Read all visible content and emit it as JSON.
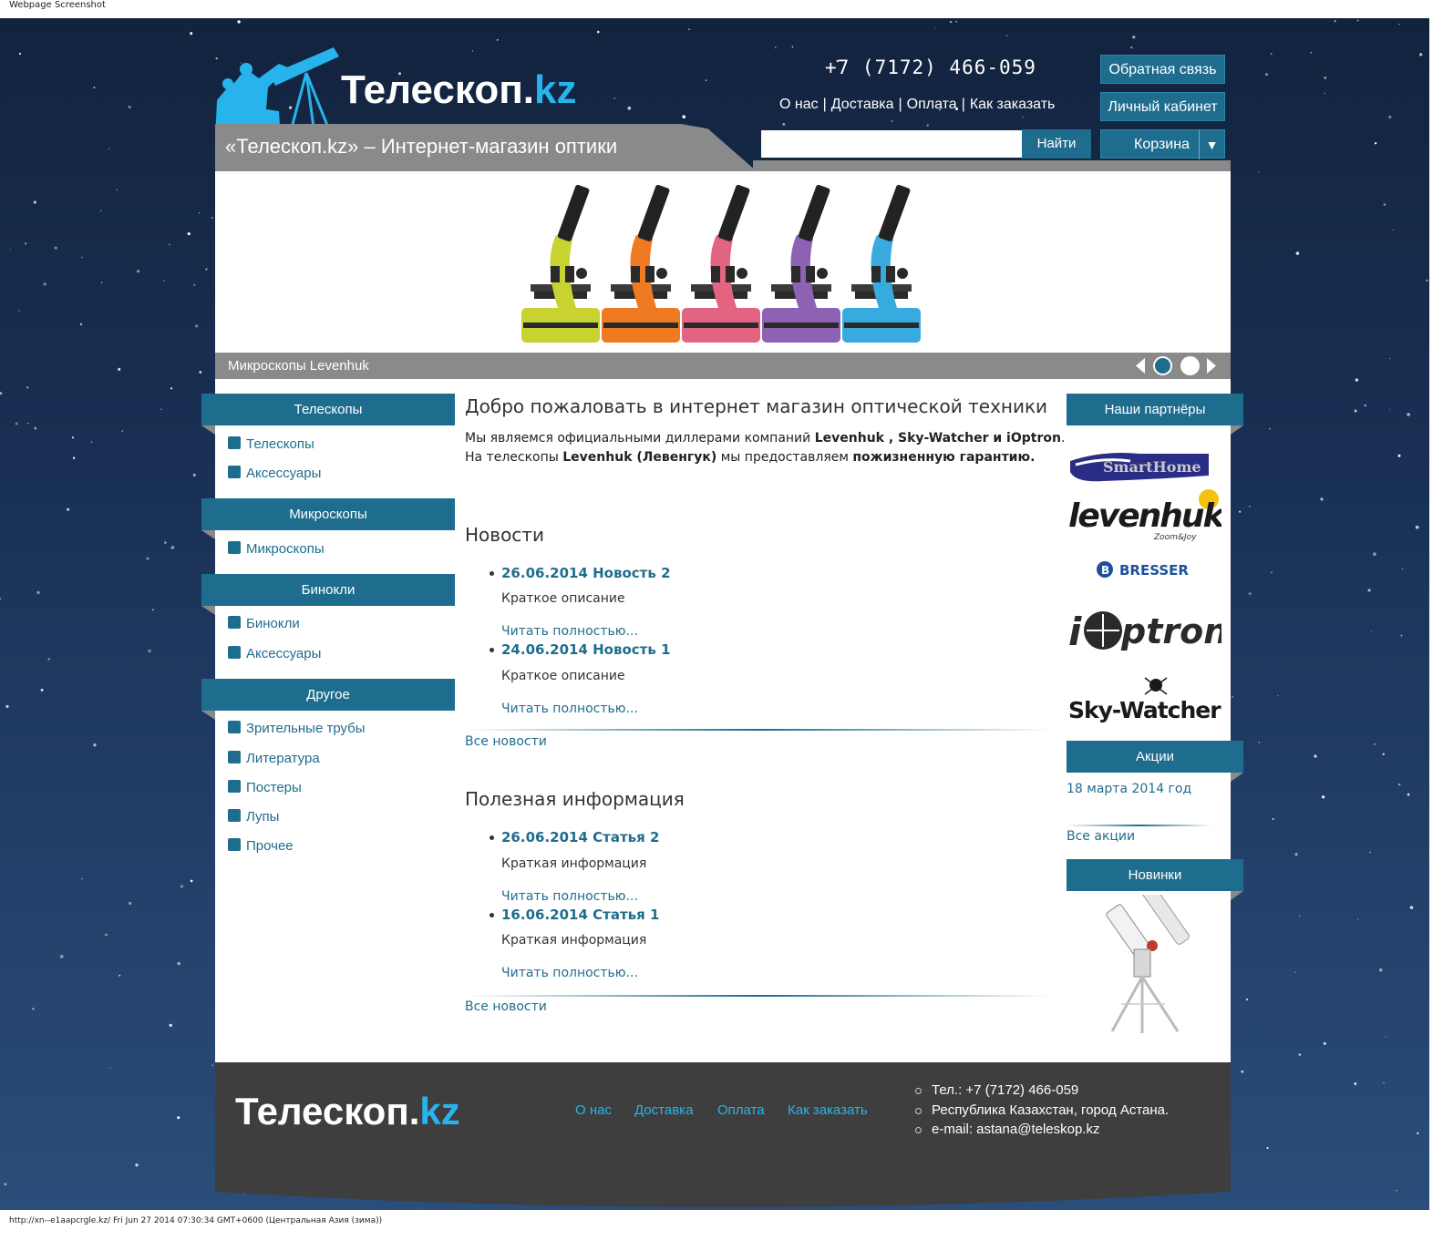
{
  "captions": {
    "top": "Webpage Screenshot",
    "bottom": "http://xn--e1aapcrgle.kz/ Fri Jun 27 2014 07:30:34 GMT+0600 (Центральная Азия (зима))"
  },
  "brand": {
    "name": "Телескоп.",
    "tld": "kz"
  },
  "header": {
    "phone": "+7 (7172) 466-059",
    "nav": [
      "О нас",
      "Доставка",
      "Оплата",
      "Как заказать"
    ],
    "separator": "|",
    "feedback_btn": "Обратная связь",
    "account_btn": "Личный кабинет",
    "tagline": "«Телескоп.kz» – Интернет-магазин оптики",
    "search_btn": "Найти",
    "cart_btn": "Корзина",
    "cart_arrow": "▼"
  },
  "slider": {
    "caption": "Микроскопы Levenhuk",
    "microscope_colors": [
      "#c8d230",
      "#ef7a22",
      "#e26480",
      "#8d62b4",
      "#37aadf"
    ],
    "active_dot": 1
  },
  "left_menu": [
    {
      "title": "Телескопы",
      "items": [
        "Телескопы",
        "Аксессуары"
      ]
    },
    {
      "title": "Микроскопы",
      "items": [
        "Микроскопы"
      ]
    },
    {
      "title": "Бинокли",
      "items": [
        "Бинокли",
        "Аксессуары"
      ]
    },
    {
      "title": "Другое",
      "items": [
        "Зрительные трубы",
        "Литература",
        "Постеры",
        "Лупы",
        "Прочее"
      ]
    }
  ],
  "main": {
    "welcome": "Добро пожаловать в интернет магазин оптической техники",
    "intro": {
      "l1_a": "Мы являемся официальными диллерами компаний ",
      "l1_b": "Levenhuk , Sky-Watcher и iOptron",
      "l1_c": ".",
      "l2_a": "На телескопы ",
      "l2_b": "Levenhuk (Левенгук)",
      "l2_c": " мы предоставляем ",
      "l2_d": "пожизненную гарантию."
    },
    "news_title": "Новости",
    "news": [
      {
        "head": "26.06.2014 Новость 2",
        "desc": "Краткое описание",
        "more": "Читать полностью..."
      },
      {
        "head": "24.06.2014 Новость 1",
        "desc": "Краткое описание",
        "more": "Читать полностью..."
      }
    ],
    "news_all": "Все новости",
    "info_title": "Полезная информация",
    "info": [
      {
        "head": "26.06.2014 Статья 2",
        "desc": "Краткая информация",
        "more": "Читать полностью..."
      },
      {
        "head": "16.06.2014 Статья 1",
        "desc": "Краткая информация",
        "more": "Читать полностью..."
      }
    ],
    "info_all": "Все новости"
  },
  "right": {
    "partners_title": "Наши партнёры",
    "partners": [
      "SmartHome",
      "levenhuk",
      "Zoom&Joy",
      "BRESSER",
      "ptron",
      "Sky-Watcher"
    ],
    "promo_title": "Акции",
    "promo_item": "18 марта 2014 год",
    "promo_all": "Все акции",
    "new_title": "Новинки"
  },
  "footer": {
    "nav": [
      "О нас",
      "Доставка",
      "Оплата",
      "Как заказать"
    ],
    "info": [
      "Тел.: +7 (7172) 466-059",
      "Республика Казахстан, город Астана.",
      "e-mail: astana@teleskop.kz"
    ]
  }
}
